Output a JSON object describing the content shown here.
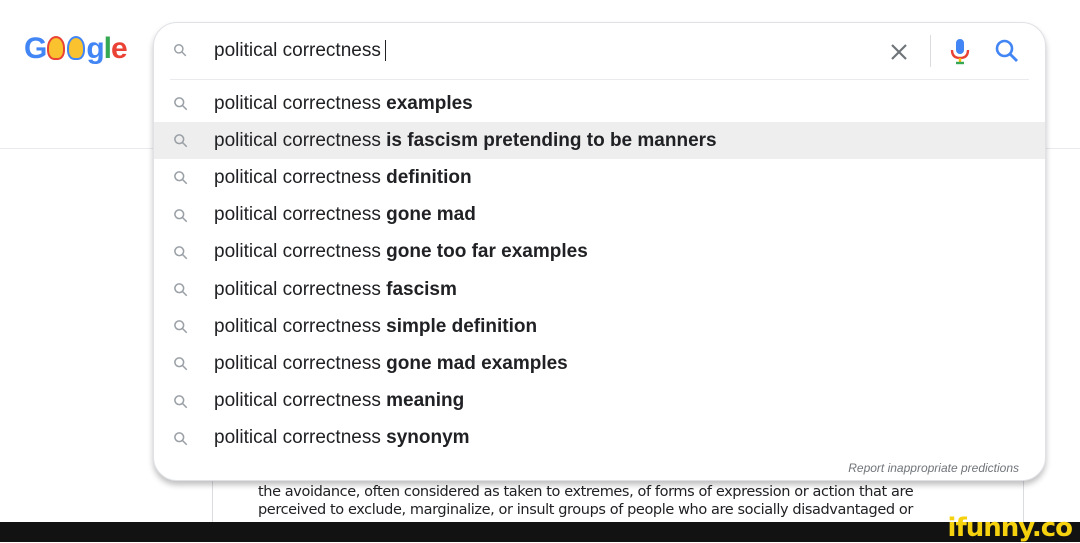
{
  "logo": {
    "text": "Google"
  },
  "search": {
    "query": "political correctness",
    "clear_icon": "close-icon",
    "mic_icon": "microphone-icon",
    "search_icon": "search-icon"
  },
  "suggestions": [
    {
      "prefix": "political correctness ",
      "bold": "examples"
    },
    {
      "prefix": "political correctness ",
      "bold": "is fascism pretending to be manners"
    },
    {
      "prefix": "political correctness ",
      "bold": "definition"
    },
    {
      "prefix": "political correctness ",
      "bold": "gone mad"
    },
    {
      "prefix": "political correctness ",
      "bold": "gone too far examples"
    },
    {
      "prefix": "political correctness ",
      "bold": "fascism"
    },
    {
      "prefix": "political correctness ",
      "bold": "simple definition"
    },
    {
      "prefix": "political correctness ",
      "bold": "gone mad examples"
    },
    {
      "prefix": "political correctness ",
      "bold": "meaning"
    },
    {
      "prefix": "political correctness ",
      "bold": "synonym"
    }
  ],
  "report_link": "Report inappropriate predictions",
  "definition": {
    "text": "the avoidance, often considered as taken to extremes, of forms of expression or action that are perceived to exclude, marginalize, or insult groups of people who are socially disadvantaged or"
  },
  "watermark": "ifunny.co",
  "colors": {
    "blue": "#4285f4",
    "red": "#ea4335",
    "yellow": "#fbbc05",
    "green": "#34a853",
    "highlight": "#eeeeee"
  }
}
